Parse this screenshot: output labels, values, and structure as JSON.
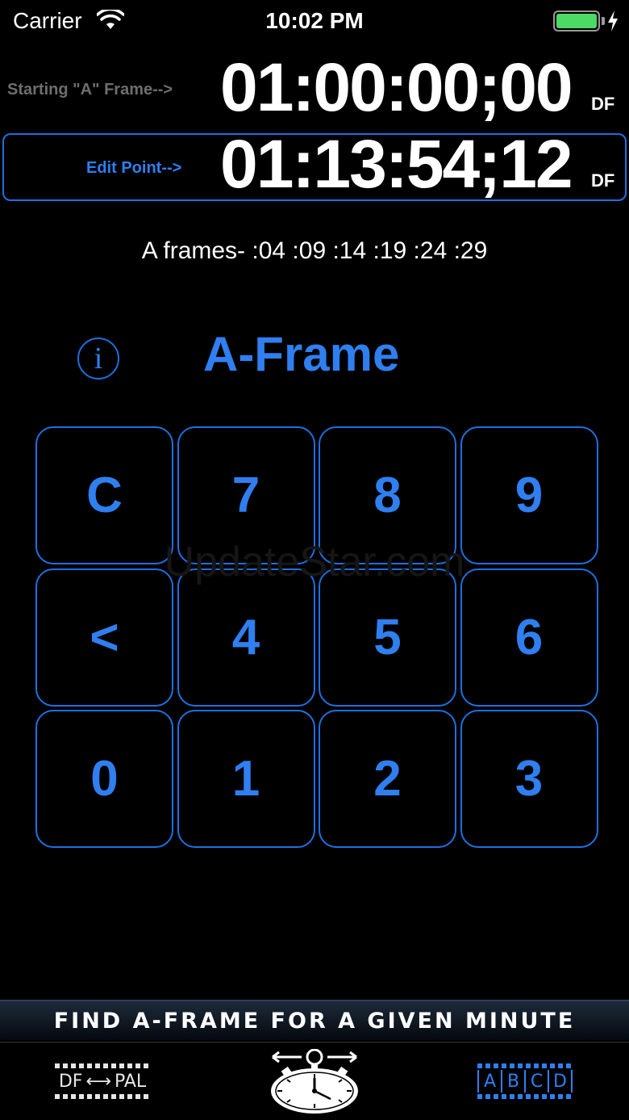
{
  "status": {
    "carrier": "Carrier",
    "time": "10:02 PM",
    "battery_level": 1.0
  },
  "start": {
    "label": "Starting \"A\" Frame-->",
    "timecode": "01:00:00;00",
    "mode": "DF"
  },
  "edit": {
    "label": "Edit Point-->",
    "timecode": "01:13:54;12",
    "mode": "DF"
  },
  "aframes_text": "A frames- :04 :09 :14 :19 :24 :29",
  "info_glyph": "i",
  "mode_title": "A-Frame",
  "keys": [
    {
      "name": "clear-key",
      "label": "C"
    },
    {
      "name": "key-7",
      "label": "7"
    },
    {
      "name": "key-8",
      "label": "8"
    },
    {
      "name": "key-9",
      "label": "9"
    },
    {
      "name": "backspace-key",
      "label": "<"
    },
    {
      "name": "key-4",
      "label": "4"
    },
    {
      "name": "key-5",
      "label": "5"
    },
    {
      "name": "key-6",
      "label": "6"
    },
    {
      "name": "key-0",
      "label": "0"
    },
    {
      "name": "key-1",
      "label": "1"
    },
    {
      "name": "key-2",
      "label": "2"
    },
    {
      "name": "key-3",
      "label": "3"
    }
  ],
  "watermark": "UpdateStar.com",
  "banner": "FIND A-FRAME FOR A GIVEN MINUTE",
  "tabs": {
    "df_pal": {
      "left": "DF",
      "arrow": "⟷",
      "right": "PAL",
      "icon": "df-pal-film-icon"
    },
    "timer": {
      "icon": "stopwatch-icon"
    },
    "abcd": {
      "letters": [
        "A",
        "B",
        "C",
        "D"
      ],
      "icon": "abcd-film-icon"
    }
  },
  "colors": {
    "accent": "#2f7ff0",
    "border": "#1f6fe0",
    "battery": "#4cd964",
    "label_gray": "#6e6e6e"
  }
}
